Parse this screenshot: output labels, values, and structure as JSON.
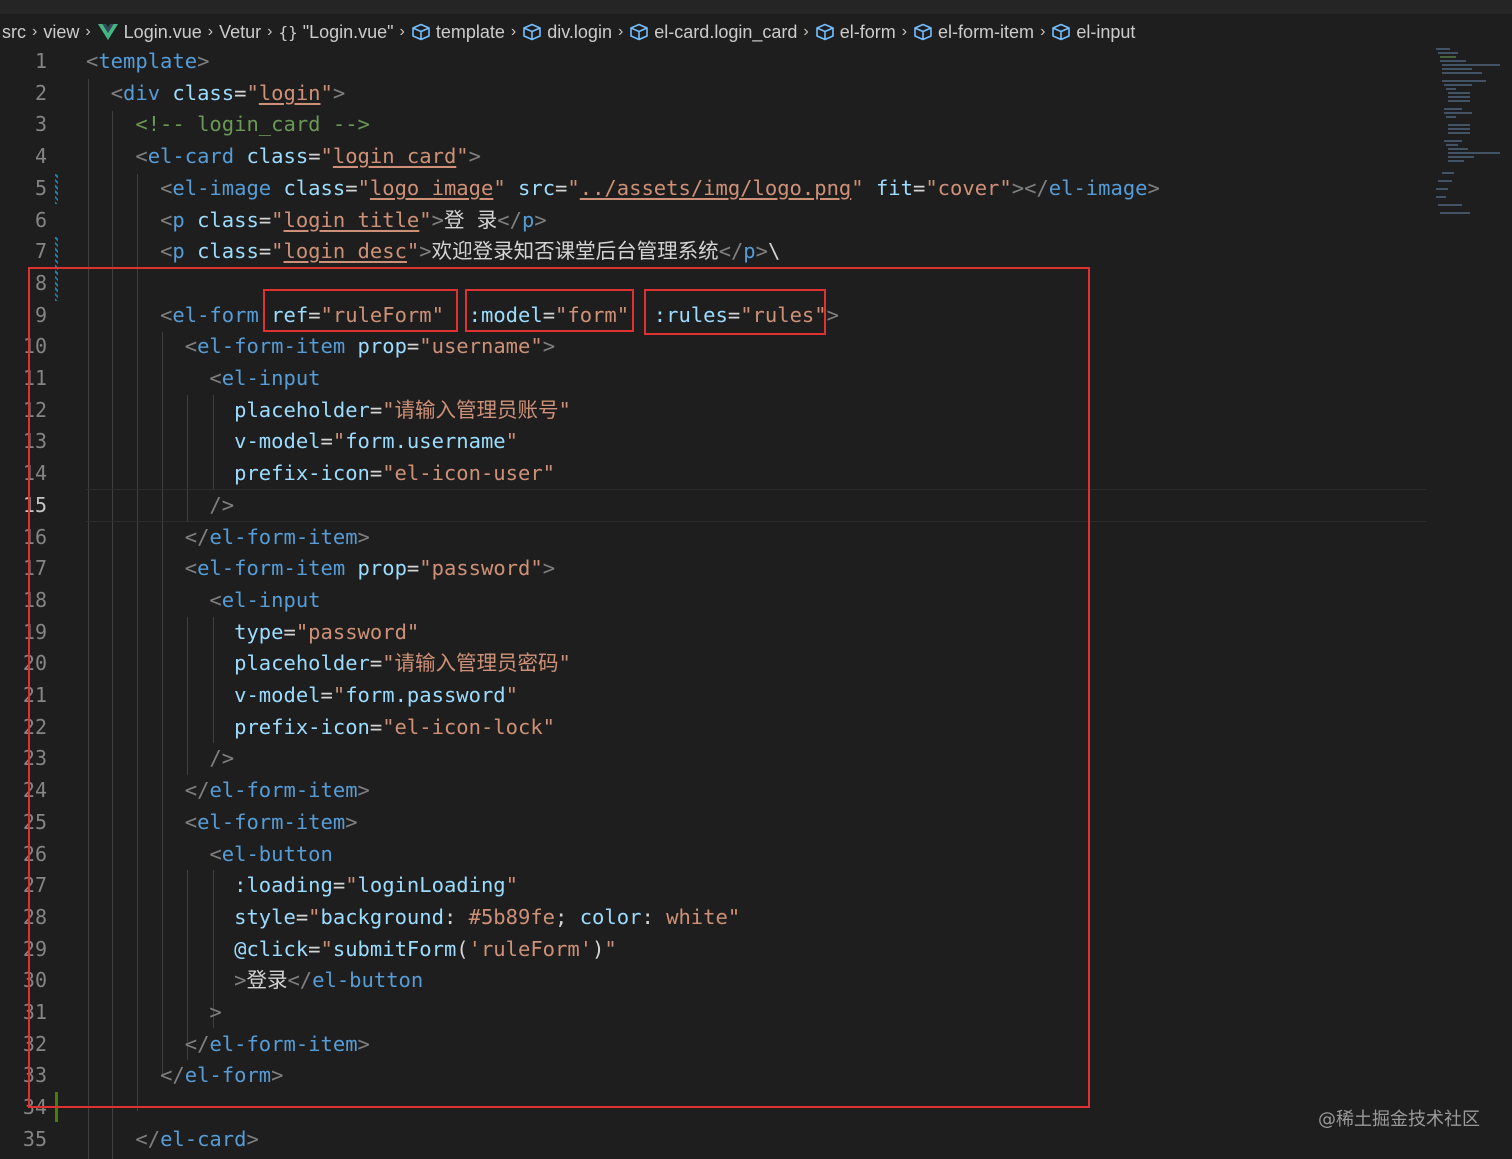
{
  "breadcrumb": [
    {
      "label": "src"
    },
    {
      "label": "view"
    },
    {
      "label": "Login.vue",
      "icon": "vue-icon"
    },
    {
      "label": "Vetur"
    },
    {
      "label": "\"Login.vue\"",
      "icon": "braces-icon"
    },
    {
      "label": "template",
      "icon": "cube-icon"
    },
    {
      "label": "div.login",
      "icon": "cube-icon"
    },
    {
      "label": "el-card.login_card",
      "icon": "cube-icon"
    },
    {
      "label": "el-form",
      "icon": "cube-icon"
    },
    {
      "label": "el-form-item",
      "icon": "cube-icon"
    },
    {
      "label": "el-input",
      "icon": "cube-icon"
    }
  ],
  "editor": {
    "active_line": 15,
    "lines": [
      {
        "n": "1",
        "seg": [
          [
            "punct",
            "<"
          ],
          [
            "tag",
            "template"
          ],
          [
            "punct",
            ">"
          ]
        ]
      },
      {
        "n": "2",
        "seg": [
          [
            "text",
            "  "
          ],
          [
            "punct",
            "<"
          ],
          [
            "tag",
            "div"
          ],
          [
            "text",
            " "
          ],
          [
            "attr",
            "class"
          ],
          [
            "eq",
            "="
          ],
          [
            "str",
            "\""
          ],
          [
            "link",
            "login"
          ],
          [
            "str",
            "\""
          ],
          [
            "punct",
            ">"
          ]
        ]
      },
      {
        "n": "3",
        "seg": [
          [
            "text",
            "    "
          ],
          [
            "comment",
            "<!-- login_card -->"
          ]
        ]
      },
      {
        "n": "4",
        "seg": [
          [
            "text",
            "    "
          ],
          [
            "punct",
            "<"
          ],
          [
            "tag",
            "el-card"
          ],
          [
            "text",
            " "
          ],
          [
            "attr",
            "class"
          ],
          [
            "eq",
            "="
          ],
          [
            "str",
            "\""
          ],
          [
            "link",
            "login_card"
          ],
          [
            "str",
            "\""
          ],
          [
            "punct",
            ">"
          ]
        ]
      },
      {
        "n": "5",
        "seg": [
          [
            "text",
            "      "
          ],
          [
            "punct",
            "<"
          ],
          [
            "tag",
            "el-image"
          ],
          [
            "text",
            " "
          ],
          [
            "attr",
            "class"
          ],
          [
            "eq",
            "="
          ],
          [
            "str",
            "\""
          ],
          [
            "link",
            "logo_image"
          ],
          [
            "str",
            "\""
          ],
          [
            "text",
            " "
          ],
          [
            "attr",
            "src"
          ],
          [
            "eq",
            "="
          ],
          [
            "str",
            "\""
          ],
          [
            "link",
            "../assets/img/logo.png"
          ],
          [
            "str",
            "\""
          ],
          [
            "text",
            " "
          ],
          [
            "attr",
            "fit"
          ],
          [
            "eq",
            "="
          ],
          [
            "str",
            "\"cover\""
          ],
          [
            "punct",
            "></"
          ],
          [
            "tag",
            "el-image"
          ],
          [
            "punct",
            ">"
          ]
        ]
      },
      {
        "n": "6",
        "seg": [
          [
            "text",
            "      "
          ],
          [
            "punct",
            "<"
          ],
          [
            "tag",
            "p"
          ],
          [
            "text",
            " "
          ],
          [
            "attr",
            "class"
          ],
          [
            "eq",
            "="
          ],
          [
            "str",
            "\""
          ],
          [
            "link",
            "login_title"
          ],
          [
            "str",
            "\""
          ],
          [
            "punct",
            ">"
          ],
          [
            "text",
            "登 录"
          ],
          [
            "punct",
            "</"
          ],
          [
            "tag",
            "p"
          ],
          [
            "punct",
            ">"
          ]
        ]
      },
      {
        "n": "7",
        "seg": [
          [
            "text",
            "      "
          ],
          [
            "punct",
            "<"
          ],
          [
            "tag",
            "p"
          ],
          [
            "text",
            " "
          ],
          [
            "attr",
            "class"
          ],
          [
            "eq",
            "="
          ],
          [
            "str",
            "\""
          ],
          [
            "link",
            "login_desc"
          ],
          [
            "str",
            "\""
          ],
          [
            "punct",
            ">"
          ],
          [
            "text",
            "欢迎登录知否课堂后台管理系统"
          ],
          [
            "punct",
            "</"
          ],
          [
            "tag",
            "p"
          ],
          [
            "punct",
            ">"
          ],
          [
            "text",
            "\\"
          ]
        ]
      },
      {
        "n": "8",
        "seg": []
      },
      {
        "n": "9",
        "seg": [
          [
            "text",
            "      "
          ],
          [
            "punct",
            "<"
          ],
          [
            "tag",
            "el-form"
          ],
          [
            "text",
            " "
          ],
          [
            "attr",
            "ref"
          ],
          [
            "eq",
            "="
          ],
          [
            "str",
            "\"ruleForm\""
          ],
          [
            "text",
            "  "
          ],
          [
            "attr",
            ":model"
          ],
          [
            "eq",
            "="
          ],
          [
            "str",
            "\"form\""
          ],
          [
            "text",
            "  "
          ],
          [
            "attr",
            ":rules"
          ],
          [
            "eq",
            "="
          ],
          [
            "str",
            "\"rules\""
          ],
          [
            "punct",
            ">"
          ]
        ]
      },
      {
        "n": "10",
        "seg": [
          [
            "text",
            "        "
          ],
          [
            "punct",
            "<"
          ],
          [
            "tag",
            "el-form-item"
          ],
          [
            "text",
            " "
          ],
          [
            "attr",
            "prop"
          ],
          [
            "eq",
            "="
          ],
          [
            "str",
            "\"username\""
          ],
          [
            "punct",
            ">"
          ]
        ]
      },
      {
        "n": "11",
        "seg": [
          [
            "text",
            "          "
          ],
          [
            "punct",
            "<"
          ],
          [
            "tag",
            "el-input"
          ]
        ]
      },
      {
        "n": "12",
        "seg": [
          [
            "text",
            "            "
          ],
          [
            "attr",
            "placeholder"
          ],
          [
            "eq",
            "="
          ],
          [
            "str",
            "\"请输入管理员账号\""
          ]
        ]
      },
      {
        "n": "13",
        "seg": [
          [
            "text",
            "            "
          ],
          [
            "attr",
            "v-model"
          ],
          [
            "eq",
            "="
          ],
          [
            "str",
            "\""
          ],
          [
            "attr",
            "form.username"
          ],
          [
            "str",
            "\""
          ]
        ]
      },
      {
        "n": "14",
        "seg": [
          [
            "text",
            "            "
          ],
          [
            "attr",
            "prefix-icon"
          ],
          [
            "eq",
            "="
          ],
          [
            "str",
            "\"el-icon-user\""
          ]
        ]
      },
      {
        "n": "15",
        "seg": [
          [
            "text",
            "          "
          ],
          [
            "punct",
            "/>"
          ]
        ]
      },
      {
        "n": "16",
        "seg": [
          [
            "text",
            "        "
          ],
          [
            "punct",
            "</"
          ],
          [
            "tag",
            "el-form-item"
          ],
          [
            "punct",
            ">"
          ]
        ]
      },
      {
        "n": "17",
        "seg": [
          [
            "text",
            "        "
          ],
          [
            "punct",
            "<"
          ],
          [
            "tag",
            "el-form-item"
          ],
          [
            "text",
            " "
          ],
          [
            "attr",
            "prop"
          ],
          [
            "eq",
            "="
          ],
          [
            "str",
            "\"password\""
          ],
          [
            "punct",
            ">"
          ]
        ]
      },
      {
        "n": "18",
        "seg": [
          [
            "text",
            "          "
          ],
          [
            "punct",
            "<"
          ],
          [
            "tag",
            "el-input"
          ]
        ]
      },
      {
        "n": "19",
        "seg": [
          [
            "text",
            "            "
          ],
          [
            "attr",
            "type"
          ],
          [
            "eq",
            "="
          ],
          [
            "str",
            "\"password\""
          ]
        ]
      },
      {
        "n": "20",
        "seg": [
          [
            "text",
            "            "
          ],
          [
            "attr",
            "placeholder"
          ],
          [
            "eq",
            "="
          ],
          [
            "str",
            "\"请输入管理员密码\""
          ]
        ]
      },
      {
        "n": "21",
        "seg": [
          [
            "text",
            "            "
          ],
          [
            "attr",
            "v-model"
          ],
          [
            "eq",
            "="
          ],
          [
            "str",
            "\""
          ],
          [
            "attr",
            "form.password"
          ],
          [
            "str",
            "\""
          ]
        ]
      },
      {
        "n": "22",
        "seg": [
          [
            "text",
            "            "
          ],
          [
            "attr",
            "prefix-icon"
          ],
          [
            "eq",
            "="
          ],
          [
            "str",
            "\"el-icon-lock\""
          ]
        ]
      },
      {
        "n": "23",
        "seg": [
          [
            "text",
            "          "
          ],
          [
            "punct",
            "/>"
          ]
        ]
      },
      {
        "n": "24",
        "seg": [
          [
            "text",
            "        "
          ],
          [
            "punct",
            "</"
          ],
          [
            "tag",
            "el-form-item"
          ],
          [
            "punct",
            ">"
          ]
        ]
      },
      {
        "n": "25",
        "seg": [
          [
            "text",
            "        "
          ],
          [
            "punct",
            "<"
          ],
          [
            "tag",
            "el-form-item"
          ],
          [
            "punct",
            ">"
          ]
        ]
      },
      {
        "n": "26",
        "seg": [
          [
            "text",
            "          "
          ],
          [
            "punct",
            "<"
          ],
          [
            "tag",
            "el-button"
          ]
        ]
      },
      {
        "n": "27",
        "seg": [
          [
            "text",
            "            "
          ],
          [
            "attr",
            ":loading"
          ],
          [
            "eq",
            "="
          ],
          [
            "str",
            "\""
          ],
          [
            "attr",
            "loginLoading"
          ],
          [
            "str",
            "\""
          ]
        ]
      },
      {
        "n": "28",
        "seg": [
          [
            "text",
            "            "
          ],
          [
            "attr",
            "style"
          ],
          [
            "eq",
            "="
          ],
          [
            "str",
            "\""
          ],
          [
            "attr",
            "background"
          ],
          [
            "text",
            ": "
          ],
          [
            "str",
            "#5b89fe"
          ],
          [
            "text",
            "; "
          ],
          [
            "attr",
            "color"
          ],
          [
            "text",
            ": "
          ],
          [
            "str",
            "white"
          ],
          [
            "str",
            "\""
          ]
        ]
      },
      {
        "n": "29",
        "seg": [
          [
            "text",
            "            "
          ],
          [
            "attr",
            "@click"
          ],
          [
            "eq",
            "="
          ],
          [
            "str",
            "\""
          ],
          [
            "attr",
            "submitForm"
          ],
          [
            "text",
            "("
          ],
          [
            "str",
            "'ruleForm'"
          ],
          [
            "text",
            ")"
          ],
          [
            "str",
            "\""
          ]
        ]
      },
      {
        "n": "30",
        "seg": [
          [
            "text",
            "            "
          ],
          [
            "punct",
            ">"
          ],
          [
            "text",
            "登录"
          ],
          [
            "punct",
            "</"
          ],
          [
            "tag",
            "el-button"
          ]
        ]
      },
      {
        "n": "31",
        "seg": [
          [
            "text",
            "          "
          ],
          [
            "punct",
            ">"
          ]
        ]
      },
      {
        "n": "32",
        "seg": [
          [
            "text",
            "        "
          ],
          [
            "punct",
            "</"
          ],
          [
            "tag",
            "el-form-item"
          ],
          [
            "punct",
            ">"
          ]
        ]
      },
      {
        "n": "33",
        "seg": [
          [
            "text",
            "      "
          ],
          [
            "punct",
            "</"
          ],
          [
            "tag",
            "el-form"
          ],
          [
            "punct",
            ">"
          ]
        ]
      },
      {
        "n": "34",
        "seg": []
      },
      {
        "n": "35",
        "seg": [
          [
            "text",
            "    "
          ],
          [
            "punct",
            "</"
          ],
          [
            "tag",
            "el-card"
          ],
          [
            "punct",
            ">"
          ]
        ]
      }
    ]
  },
  "colors": {
    "background": "#1e1e1e",
    "highlight_box": "#e03131",
    "tag": "#569cd6",
    "attribute": "#9cdcfe",
    "string": "#ce9178",
    "comment": "#6a9955"
  },
  "watermark": "@稀土掘金技术社区"
}
